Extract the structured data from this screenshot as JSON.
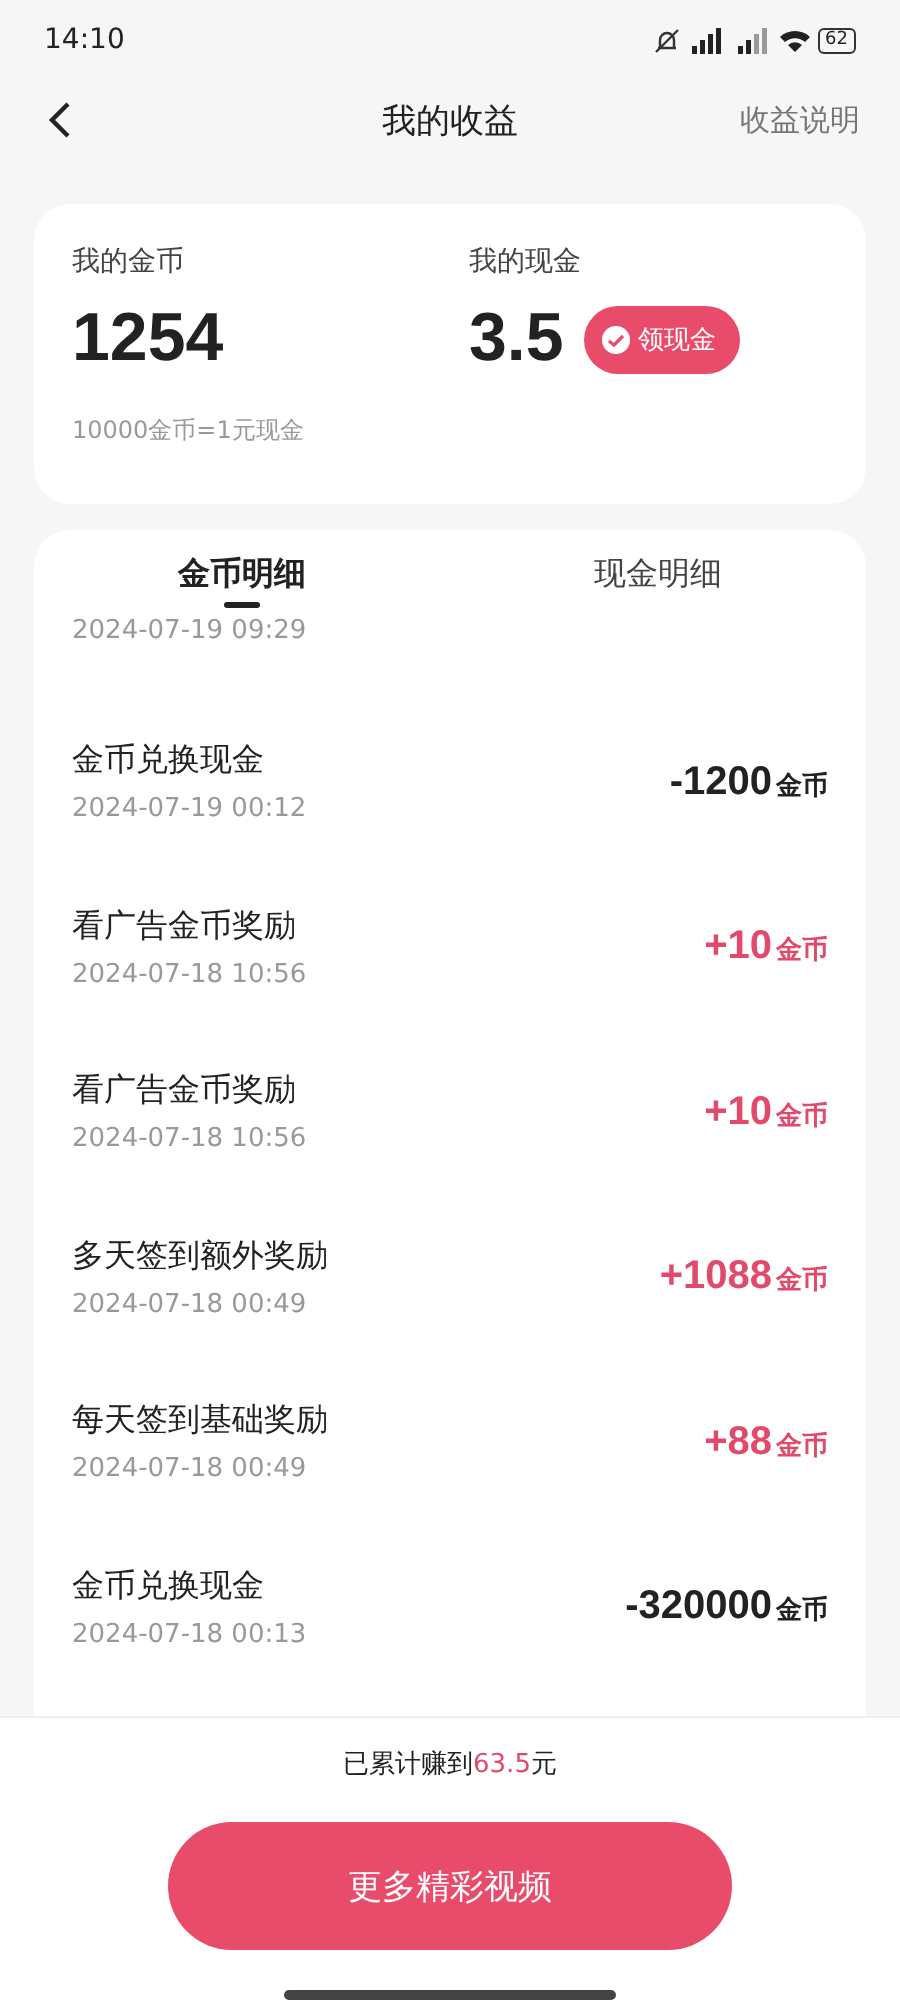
{
  "status_bar": {
    "time": "14:10",
    "battery": "62"
  },
  "header": {
    "title": "我的收益",
    "link": "收益说明"
  },
  "summary": {
    "coins_label": "我的金币",
    "coins": "1254",
    "cash_label": "我的现金",
    "cash": "3.5",
    "claim_button": "领现金",
    "rate": "10000金币=1元现金"
  },
  "tabs": [
    {
      "label": "金币明细",
      "selected": true
    },
    {
      "label": "现金明细",
      "selected": false
    }
  ],
  "records": [
    {
      "kind": "partial",
      "date": "2024-07-19 09:29"
    },
    {
      "kind": "expense",
      "title": "金币兑换现金",
      "date": "2024-07-19 00:12",
      "amount": "-1200",
      "unit": "金币"
    },
    {
      "kind": "income",
      "title": "看广告金币奖励",
      "date": "2024-07-18 10:56",
      "amount": "+10",
      "unit": "金币"
    },
    {
      "kind": "income",
      "title": "看广告金币奖励",
      "date": "2024-07-18 10:56",
      "amount": "+10",
      "unit": "金币"
    },
    {
      "kind": "income",
      "title": "多天签到额外奖励",
      "date": "2024-07-18 00:49",
      "amount": "+1088",
      "unit": "金币"
    },
    {
      "kind": "income",
      "title": "每天签到基础奖励",
      "date": "2024-07-18 00:49",
      "amount": "+88",
      "unit": "金币"
    },
    {
      "kind": "expense",
      "title": "金币兑换现金",
      "date": "2024-07-18 00:13",
      "amount": "-320000",
      "unit": "金币"
    }
  ],
  "footer": {
    "total": "已累计赚到**63.5**元",
    "button": "更多精彩视频"
  }
}
